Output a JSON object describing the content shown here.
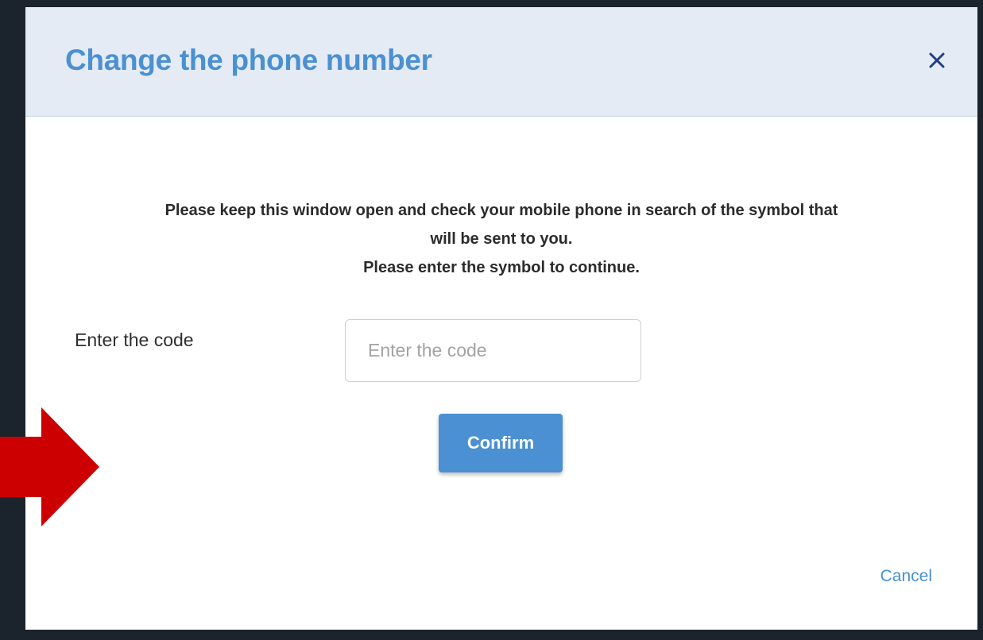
{
  "modal": {
    "title": "Change the phone number",
    "close_icon": "close-icon",
    "instructions": [
      "Please keep this window open and check your mobile phone in search of the symbol that",
      "will be sent to you.",
      "Please enter the symbol to continue."
    ],
    "code_field": {
      "label": "Enter the code",
      "placeholder": "Enter the code",
      "value": ""
    },
    "confirm_label": "Confirm",
    "cancel_label": "Cancel"
  },
  "annotation": {
    "arrow_icon": "red-arrow-icon",
    "arrow_color": "#cc0000"
  },
  "colors": {
    "accent": "#4a90d2",
    "header_bg": "#e4ebf4",
    "backdrop": "#1b232d"
  }
}
